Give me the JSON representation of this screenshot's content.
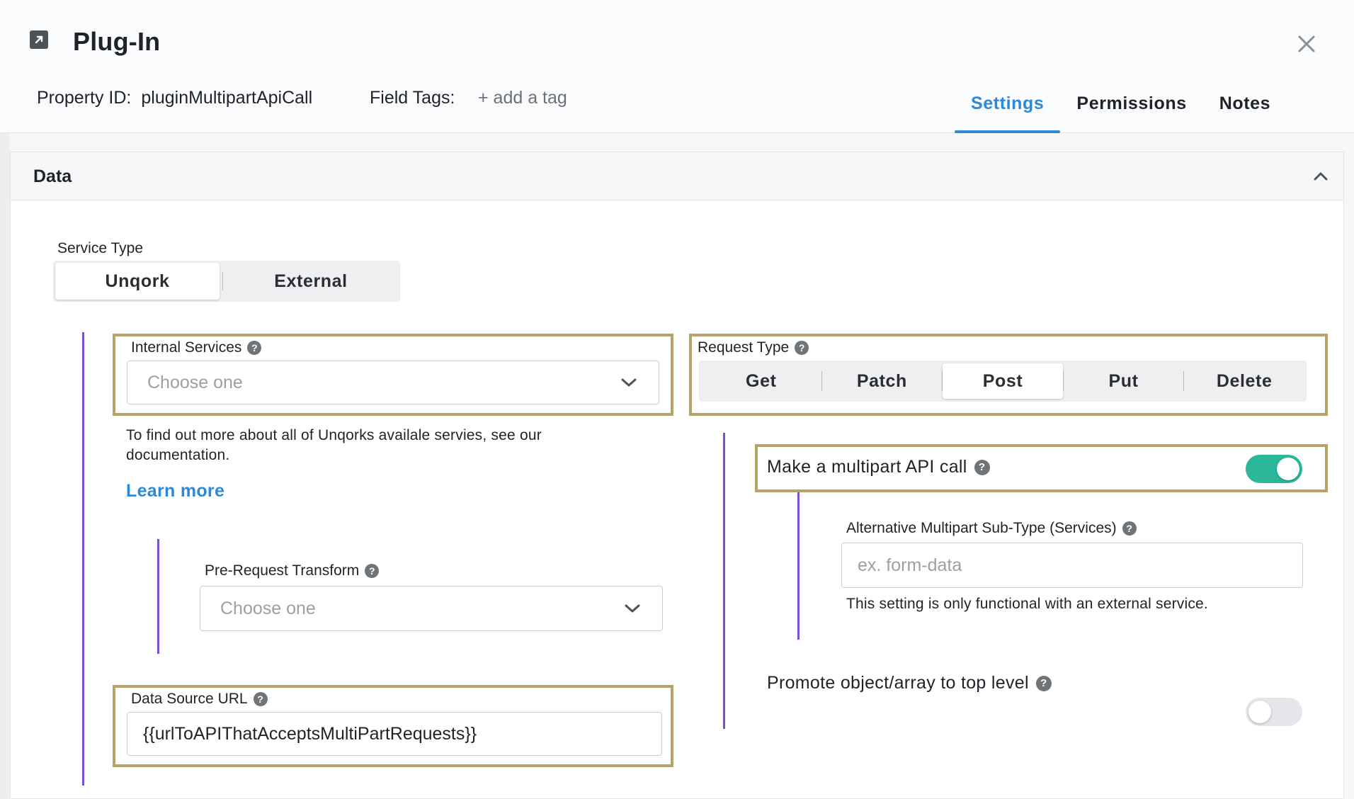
{
  "header": {
    "title": "Plug-In",
    "icon": "external-link-icon",
    "property_id_label": "Property ID:",
    "property_id_value": "pluginMultipartApiCall",
    "field_tags_label": "Field Tags:",
    "add_tag": "+ add a tag",
    "tabs": [
      {
        "label": "Settings",
        "active": true
      },
      {
        "label": "Permissions",
        "active": false
      },
      {
        "label": "Notes",
        "active": false
      }
    ],
    "accent_color": "#2b8ad8"
  },
  "panel": {
    "title": "Data",
    "service_type": {
      "label": "Service Type",
      "options": [
        "Unqork",
        "External"
      ],
      "selected": "Unqork"
    },
    "internal_services": {
      "label": "Internal Services",
      "placeholder": "Choose one"
    },
    "help_text": "To find out more about all of Unqorks availale servies, see our documentation.",
    "learn_more": "Learn more",
    "pre_request_transform": {
      "label": "Pre-Request Transform",
      "placeholder": "Choose one"
    },
    "data_source_url": {
      "label": "Data Source URL",
      "value": "{{urlToAPIThatAcceptsMultiPartRequests}}"
    },
    "request_type": {
      "label": "Request Type",
      "options": [
        "Get",
        "Patch",
        "Post",
        "Put",
        "Delete"
      ],
      "selected": "Post"
    },
    "multipart": {
      "label": "Make a multipart API call",
      "enabled": true
    },
    "alt_subtype": {
      "label": "Alternative Multipart Sub-Type (Services)",
      "placeholder": "ex. form-data",
      "note": "This setting is only functional with an external service."
    },
    "promote": {
      "label": "Promote object/array to top level",
      "enabled": false
    },
    "colors": {
      "highlight_border": "#b5a369",
      "nesting_line": "#7a4fd2",
      "toggle_on": "#2bb89a"
    }
  }
}
